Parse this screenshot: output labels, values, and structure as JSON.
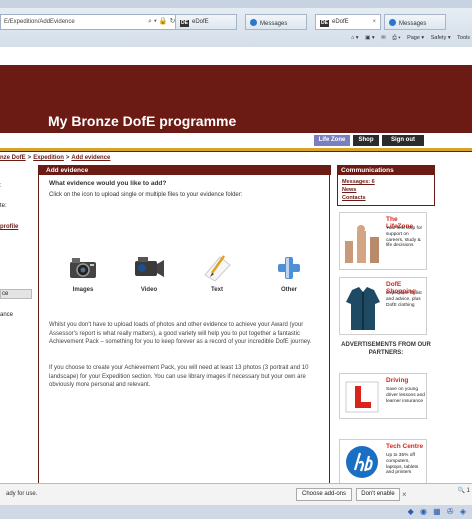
{
  "browser": {
    "address": "E/Expedition/AddEvidence",
    "tabs": [
      {
        "label": "eDofE",
        "icon": "DE",
        "active": false
      },
      {
        "label": "Messages",
        "icon": "msg",
        "active": false
      },
      {
        "label": "eDofE",
        "icon": "DE",
        "active": true
      },
      {
        "label": "Messages",
        "icon": "msg",
        "active": false
      }
    ],
    "commands": [
      "Page ▾",
      "Safety ▾",
      "Tools"
    ]
  },
  "site": {
    "title": "My Bronze DofE programme",
    "nav": [
      "Life Zone",
      "Shop",
      "Sign out"
    ],
    "accent": "#6b1a14",
    "gold": "#d8a32a"
  },
  "breadcrumb": [
    "nze DofE",
    "Expedition",
    "Add evidence"
  ],
  "left_nav": [
    ":",
    "te:",
    "profile",
    "ce",
    "ance"
  ],
  "main": {
    "header": "Add evidence",
    "question": "What evidence would you like to add?",
    "instruction": "Click on the icon to upload single or multiple files to your evidence folder:",
    "tiles": [
      "Images",
      "Video",
      "Text",
      "Other"
    ],
    "para1": "Whilst you don't have to upload loads of photos and other evidence to achieve your Award (your Assessor's report is what really matters), a good variety will help you to put together a fantastic Achievement Pack – something for you to keep forever as a record of your incredible DofE journey.",
    "para2": "If you choose to create your Achievement Pack, you will need at least 13 photos (3 portrait and 10 landscape) for your Expedition section. You can use library images if necessary but your own are obviously more personal and relevant."
  },
  "communications": {
    "header": "Communications",
    "links": [
      "Messages: 6",
      "News",
      "Contacts"
    ]
  },
  "ads": [
    {
      "title": "The LifeZone",
      "text": "Your first stop for support on careers, study & life decisions"
    },
    {
      "title": "DofE Shopping",
      "text": "Expedition kit list and advice, plus DofE clothing"
    },
    {
      "title": "Driving",
      "text": "Save on young driver lessons and learner insurance"
    },
    {
      "title": "Tech Centre",
      "text": "Up to 35% off computers, laptops, tablets and printers"
    }
  ],
  "partners_heading": "ADVERTISEMENTS FROM OUR PARTNERS:",
  "notification": {
    "text": "ady for use.",
    "choose": "Choose add-ons",
    "dont": "Don't enable",
    "close": "×"
  },
  "zoom": "🔍 1"
}
